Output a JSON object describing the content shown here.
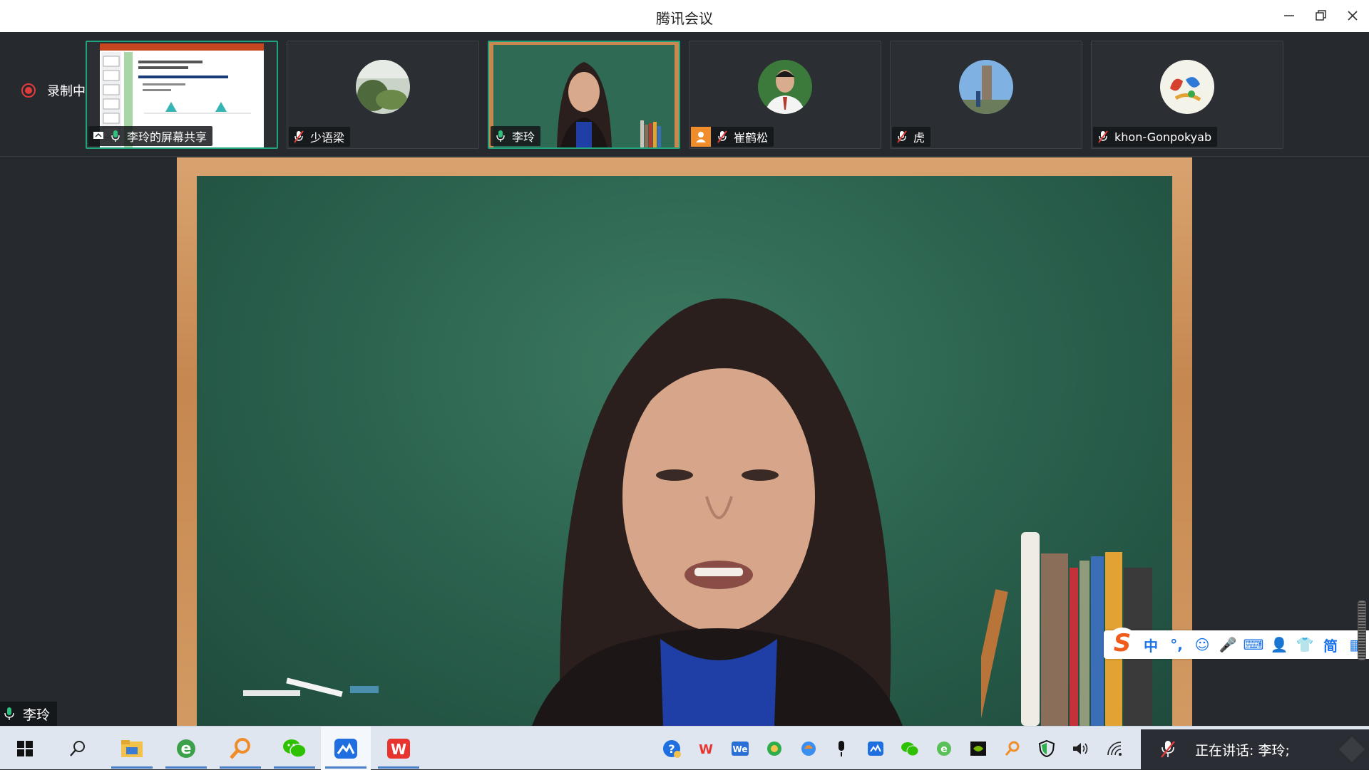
{
  "window": {
    "title": "腾讯会议"
  },
  "recording": {
    "label": "录制中"
  },
  "participants": [
    {
      "name": "李玲的屏幕共享",
      "kind": "screen-share",
      "mic": "on"
    },
    {
      "name": "少语梁",
      "kind": "avatar",
      "mic": "muted"
    },
    {
      "name": "李玲",
      "kind": "video",
      "mic": "on"
    },
    {
      "name": "崔鹤松",
      "kind": "avatar",
      "mic": "muted"
    },
    {
      "name": "虎",
      "kind": "avatar",
      "mic": "muted"
    },
    {
      "name": "khon-Gonpokyab",
      "kind": "avatar",
      "mic": "muted"
    }
  ],
  "main_video": {
    "speaker_name": "李玲"
  },
  "ime_toolbar": {
    "logo": "S",
    "items": [
      "中",
      "°,",
      "☺",
      "🎤",
      "⌨",
      "👤",
      "👕",
      "简",
      "▦"
    ]
  },
  "status_bar": {
    "speaking_label": "正在讲话: 李玲;"
  },
  "colors": {
    "accent_green": "#1fa37a",
    "record_red": "#e23b3b",
    "strip_bg": "#26292e",
    "taskbar_bg": "#dfe6ef"
  }
}
